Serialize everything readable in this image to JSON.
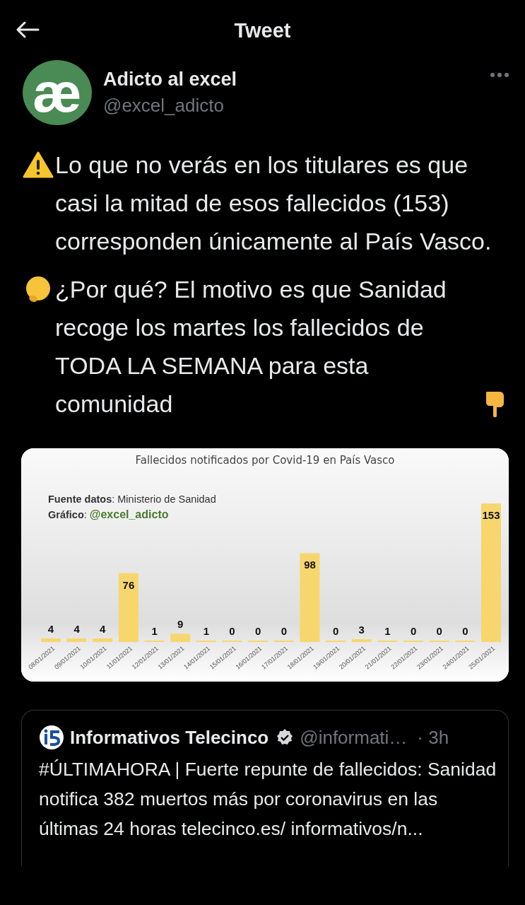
{
  "header": {
    "title": "Tweet"
  },
  "author": {
    "avatar_glyph": "æ",
    "name": "Adicto al excel",
    "handle": "@excel_adicto"
  },
  "tweet": {
    "paragraphs": [
      {
        "text": "Lo que no verás en los titulares es que casi la mitad de esos fallecidos (153) corresponden únicamente al País Vasco."
      },
      {
        "text": "¿Por qué? El motivo es que Sanidad recoge los martes los fallecidos de TODA LA SEMANA para esta comunidad"
      }
    ]
  },
  "media": {
    "source_line": "**Fuente datos**: Ministerio de Sanidad",
    "credit_label": "**Gráfico**: ",
    "credit_handle": "@excel_adicto",
    "chart_data": {
      "type": "bar",
      "title": "Fallecidos notificados por Covid-19 en País Vasco",
      "categories": [
        "08/01/2021",
        "09/01/2021",
        "10/01/2021",
        "11/01/2021",
        "12/01/2021",
        "13/01/2021",
        "14/01/2021",
        "15/01/2021",
        "16/01/2021",
        "17/01/2021",
        "18/01/2021",
        "19/01/2021",
        "20/01/2021",
        "21/01/2021",
        "22/01/2021",
        "23/01/2021",
        "24/01/2021",
        "25/01/2021"
      ],
      "series": [
        {
          "color": "#f7d66e",
          "values": [
            4,
            4,
            4,
            76,
            1,
            9,
            1,
            0,
            0,
            0,
            98,
            0,
            3,
            1,
            0,
            0,
            0,
            153
          ]
        }
      ],
      "data_labels": true
    }
  },
  "quoted": {
    "name": "Informativos Telecinco",
    "verified": true,
    "handle": "@informati…",
    "time": "· 3h",
    "text": "#ÚLTIMAHORA | Fuerte repunte de fallecidos: Sanidad notifica 382 muertos más por coronavirus en las últimas 24 horas telecinco.es/ informativos/n..."
  }
}
